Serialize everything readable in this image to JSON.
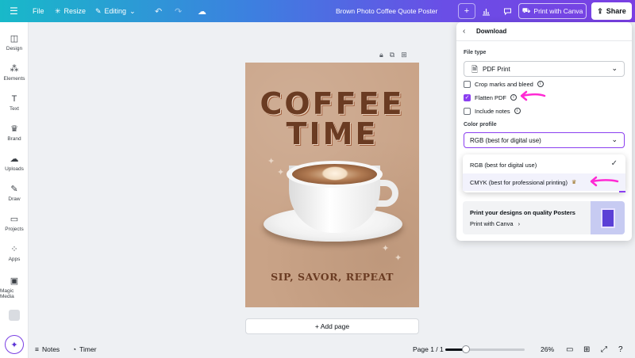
{
  "topbar": {
    "menu_icon": "hamburger-icon",
    "file_label": "File",
    "resize_label": "Resize",
    "editing_label": "Editing",
    "doc_title": "Brown Photo Coffee Quote Poster",
    "print_label": "Print with Canva",
    "share_label": "Share"
  },
  "sidebar": {
    "items": [
      {
        "label": "Design",
        "icon": "design-icon"
      },
      {
        "label": "Elements",
        "icon": "elements-icon"
      },
      {
        "label": "Text",
        "icon": "text-icon"
      },
      {
        "label": "Brand",
        "icon": "brand-icon"
      },
      {
        "label": "Uploads",
        "icon": "uploads-icon"
      },
      {
        "label": "Draw",
        "icon": "draw-icon"
      },
      {
        "label": "Projects",
        "icon": "projects-icon"
      },
      {
        "label": "Apps",
        "icon": "apps-icon"
      },
      {
        "label": "Magic Media",
        "icon": "magic-media-icon"
      }
    ]
  },
  "canvas": {
    "title_line1": "COFFEE",
    "title_line2": "TIME",
    "tagline": "SIP, SAVOR, REPEAT",
    "add_page_label": "+ Add page"
  },
  "bottombar": {
    "notes_label": "Notes",
    "timer_label": "Timer",
    "page_label": "Page 1 / 1",
    "zoom_label": "26%",
    "zoom_fraction": 0.26
  },
  "download_panel": {
    "title": "Download",
    "file_type_label": "File type",
    "file_type_value": "PDF Print",
    "options": [
      {
        "label": "Crop marks and bleed",
        "checked": false
      },
      {
        "label": "Flatten PDF",
        "checked": true
      },
      {
        "label": "Include notes",
        "checked": false
      }
    ],
    "color_profile_label": "Color profile",
    "color_profile_value": "RGB (best for digital use)",
    "dropdown_options": [
      {
        "label": "RGB (best for digital use)",
        "selected": true
      },
      {
        "label": "CMYK (best for professional printing)",
        "selected": false,
        "premium": true
      }
    ],
    "promo_title": "Print your designs on quality Posters",
    "promo_link": "Print with Canva"
  },
  "colors": {
    "accent": "#8b3ff0",
    "annotation_arrow": "#ff2ad4",
    "poster_bg": "#c9a387",
    "poster_text": "#6a3b22"
  }
}
